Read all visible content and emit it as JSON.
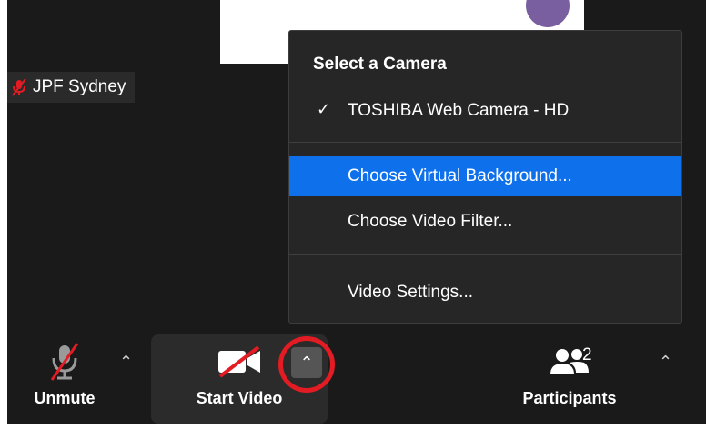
{
  "participant": {
    "name": "JPF Sydney"
  },
  "menu": {
    "title": "Select a Camera",
    "check_glyph": "✓",
    "camera": "TOSHIBA Web Camera - HD",
    "items": [
      "Choose Virtual Background...",
      "Choose Video Filter...",
      "Video Settings..."
    ]
  },
  "toolbar": {
    "unmute_label": "Unmute",
    "start_video_label": "Start Video",
    "participants_label": "Participants",
    "participants_count": "2",
    "caret": "⌃"
  },
  "colors": {
    "highlight": "#0e71eb",
    "annotation": "#e31b23",
    "muted_red": "#e31b23",
    "background": "#1a1a1a",
    "avatar": "#7a5fa0"
  },
  "icons": [
    "microphone-muted-icon",
    "video-off-icon",
    "participants-icon",
    "chevron-up-icon",
    "checkmark-icon"
  ]
}
